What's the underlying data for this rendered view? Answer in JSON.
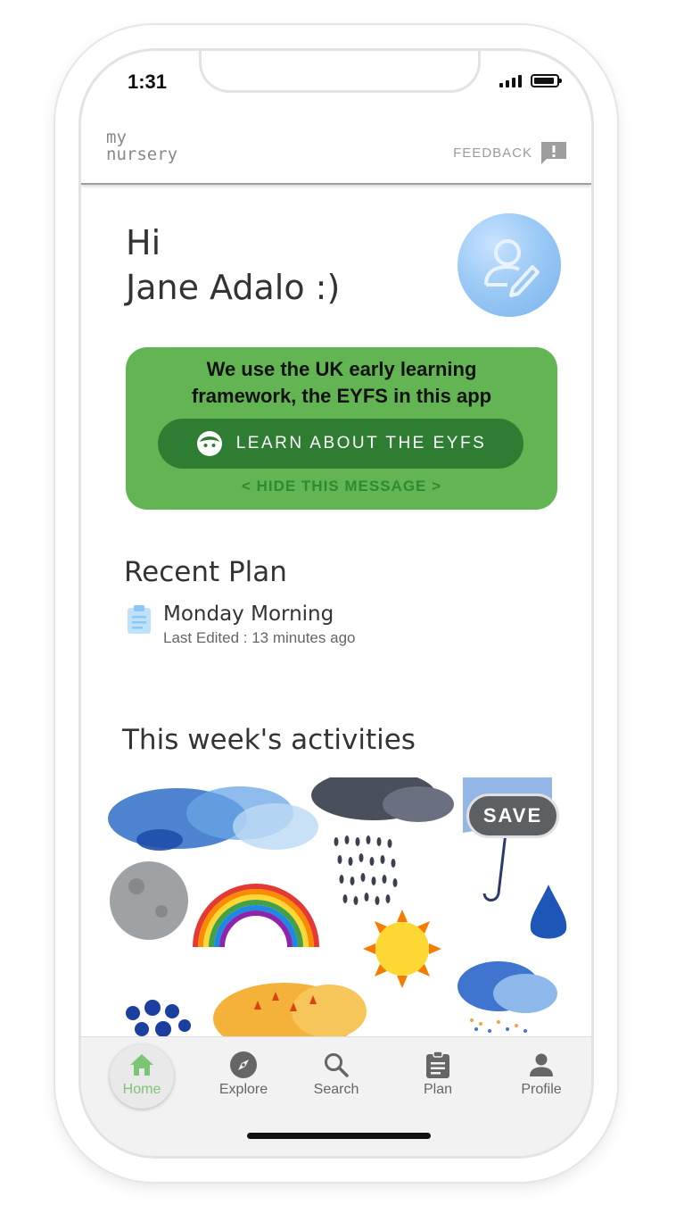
{
  "status_bar": {
    "time": "1:31"
  },
  "app_bar": {
    "logo_line1": "my",
    "logo_line2": "nursery",
    "feedback_label": "FEEDBACK"
  },
  "greeting": {
    "line1": "Hi",
    "line2": "Jane Adalo :)"
  },
  "eyfs_banner": {
    "line1": "We use the UK early learning",
    "line2": "framework, the EYFS in this app",
    "button_label": "LEARN ABOUT THE EYFS",
    "hide_label": "< HIDE THIS MESSAGE >"
  },
  "recent_plan": {
    "title": "Recent Plan",
    "item_name": "Monday Morning",
    "item_meta": "Last Edited : 13 minutes ago"
  },
  "activities": {
    "title": "This week's activities",
    "save_label": "SAVE"
  },
  "bottom_nav": {
    "items": [
      {
        "label": "Home",
        "icon": "home-icon",
        "active": true
      },
      {
        "label": "Explore",
        "icon": "compass-icon"
      },
      {
        "label": "Search",
        "icon": "search-icon"
      },
      {
        "label": "Plan",
        "icon": "clipboard-icon"
      },
      {
        "label": "Profile",
        "icon": "person-icon"
      }
    ]
  },
  "colors": {
    "brand_green": "#63b553",
    "button_green": "#2e7d32",
    "active_nav": "#7cc576"
  }
}
